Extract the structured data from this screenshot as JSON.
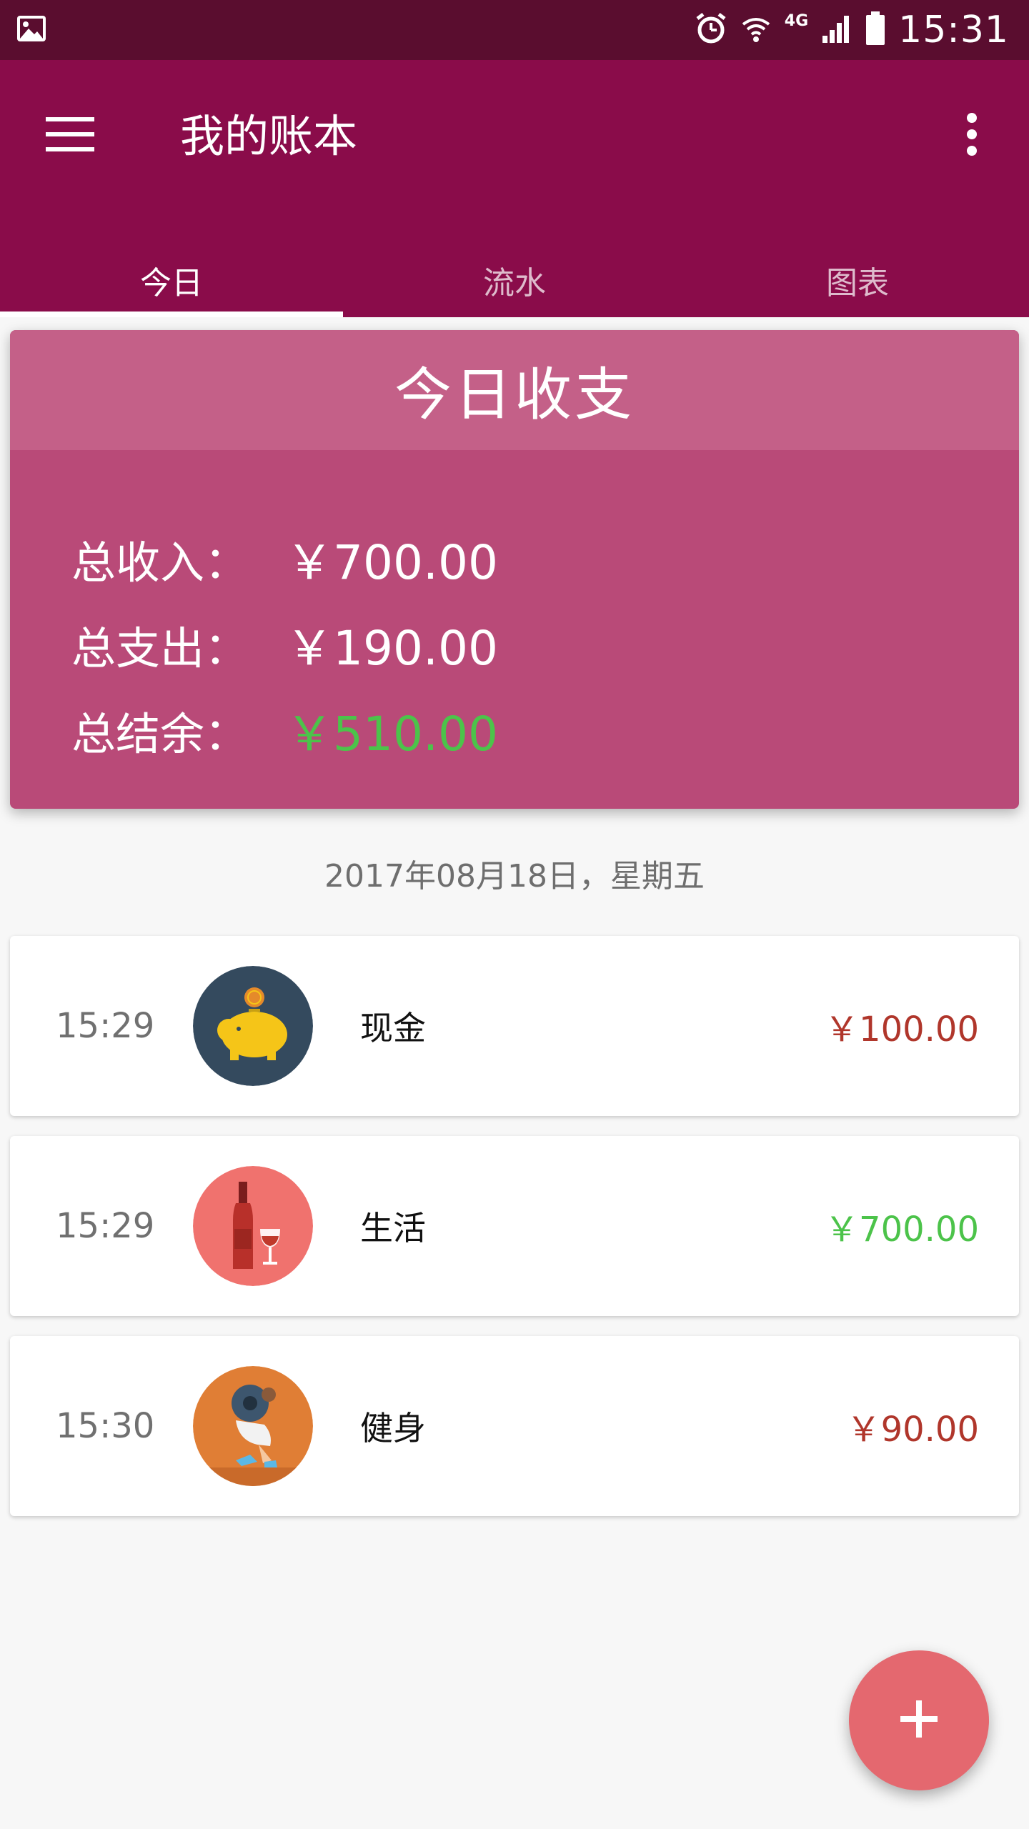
{
  "status_bar": {
    "network": "4G",
    "time": "15:31",
    "icons": [
      "image-icon",
      "alarm-icon",
      "wifi-icon",
      "signal-icon",
      "battery-icon"
    ]
  },
  "appbar": {
    "title": "我的账本",
    "menu_icon": "hamburger-menu-icon",
    "more_icon": "more-vert-icon",
    "tabs": [
      {
        "label": "今日",
        "active": true
      },
      {
        "label": "流水",
        "active": false
      },
      {
        "label": "图表",
        "active": false
      }
    ]
  },
  "summary": {
    "title": "今日收支",
    "rows": [
      {
        "label": "总收入：",
        "value": "￥700.00"
      },
      {
        "label": "总支出：",
        "value": "￥190.00"
      },
      {
        "label": "总结余：",
        "value": "￥510.00"
      }
    ]
  },
  "date": "2017年08月18日，星期五",
  "records": [
    {
      "time": "15:29",
      "category": "现金",
      "amount": "￥100.00",
      "icon": "piggy-bank-icon",
      "type": "expense"
    },
    {
      "time": "15:29",
      "category": "生活",
      "amount": "￥700.00",
      "icon": "wine-bottle-icon",
      "type": "income"
    },
    {
      "time": "15:30",
      "category": "健身",
      "amount": "￥90.00",
      "icon": "fitness-icon",
      "type": "expense"
    }
  ],
  "fab_icon": "add-icon",
  "colors": {
    "status_bar": "#5a0d2f",
    "primary": "#8a0c4a",
    "summary_card": "#b94a78",
    "summary_header": "#c46088",
    "income": "#4cc34a",
    "expense": "#b0362b",
    "fab": "#e4686f"
  }
}
